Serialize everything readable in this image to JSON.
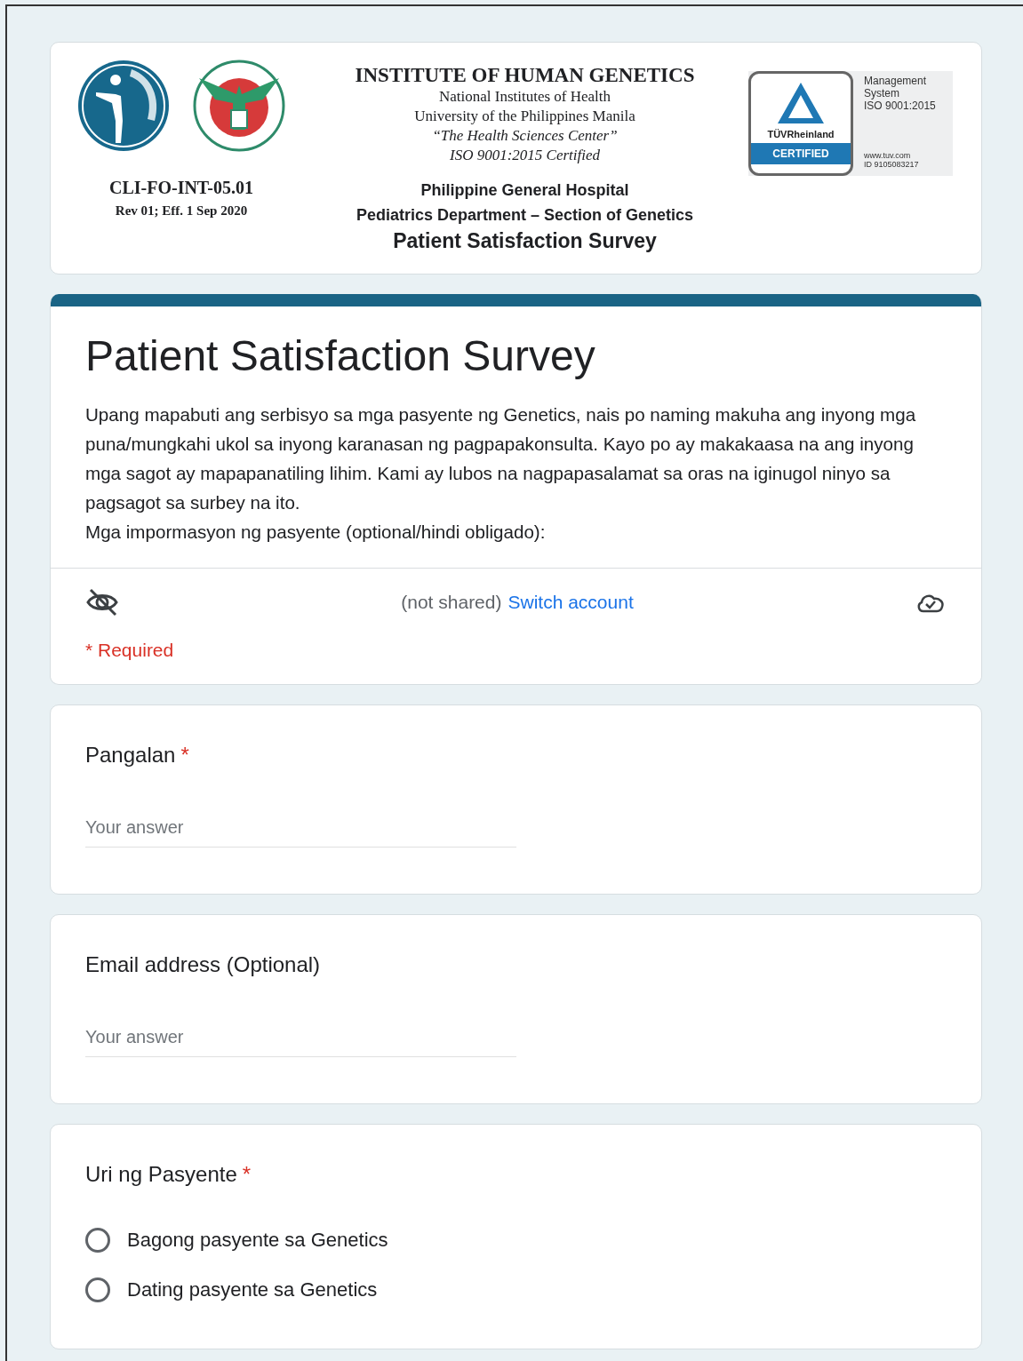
{
  "header": {
    "logos": [
      {
        "kind": "figure"
      },
      {
        "kind": "seal"
      }
    ],
    "form_code": "CLI-FO-INT-05.01",
    "revision": "Rev 01; Eff. 1 Sep 2020",
    "institute": "INSTITUTE OF HUMAN GENETICS",
    "affiliations": [
      {
        "text": "National Institutes of Health",
        "italic": false
      },
      {
        "text": "University of the Philippines Manila",
        "italic": false
      },
      {
        "text": "“The Health Sciences Center”",
        "italic": true
      },
      {
        "text": "ISO 9001:2015 Certified",
        "italic": true
      }
    ],
    "hospital": [
      "Philippine General Hospital",
      "Pediatrics Department – Section of Genetics"
    ],
    "survey_title": "Patient Satisfaction Survey",
    "badge": {
      "brand": "TÜVRheinland",
      "stamp": "CERTIFIED",
      "system": [
        "Management",
        "System",
        "ISO 9001:2015"
      ],
      "contact": [
        "www.tuv.com",
        "ID 9105083217"
      ]
    }
  },
  "form": {
    "title": "Patient Satisfaction Survey",
    "description": [
      "Upang mapabuti ang serbisyo sa mga pasyente ng Genetics, nais po naming makuha ang inyong mga puna/mungkahi ukol sa inyong karanasan ng pagpapakonsulta. Kayo po ay makakaasa na ang inyong mga sagot ay mapapanatiling lihim. Kami ay lubos na nagpapasalamat sa oras na iginugol ninyo sa pagsagot sa surbey na ito.",
      "Mga impormasyon ng pasyente (optional/hindi obligado):"
    ],
    "account_status": "(not shared)",
    "switch_link": "Switch account",
    "required_note": "* Required"
  },
  "questions": [
    {
      "kind": "text",
      "label": "Pangalan",
      "required_mark": "*",
      "placeholder": "Your answer"
    },
    {
      "kind": "text",
      "label": "Email address (Optional)",
      "placeholder": "Your answer"
    },
    {
      "kind": "radio",
      "label": "Uri ng Pasyente",
      "required_mark": "*",
      "options": [
        {
          "label": "Bagong pasyente sa Genetics",
          "selected": false
        },
        {
          "label": "Dating pasyente sa Genetics",
          "selected": false
        }
      ]
    }
  ]
}
